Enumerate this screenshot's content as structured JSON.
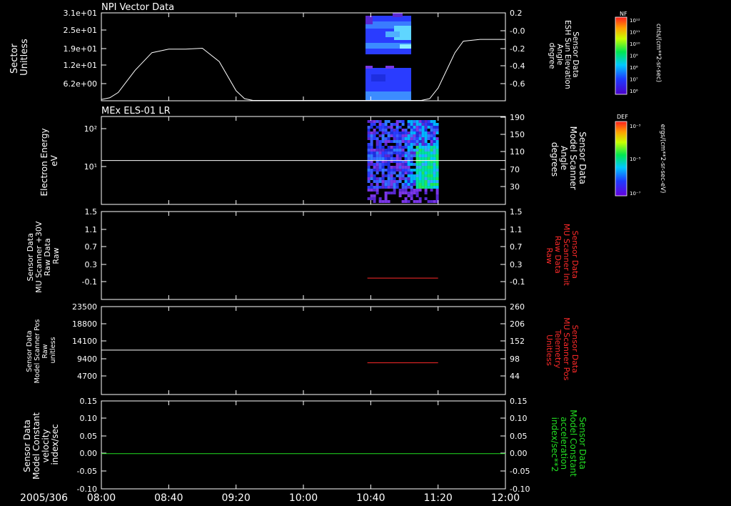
{
  "chart_data": {
    "type": "multi-panel time series",
    "time_axis": {
      "date_label": "2005/306",
      "ticks": [
        "08:00",
        "08:40",
        "09:20",
        "10:00",
        "10:40",
        "11:20",
        "12:00"
      ]
    },
    "panels": [
      {
        "title": "NPI Vector Data",
        "type": "spectrogram + line",
        "left_label": [
          "Sector",
          "Unitless"
        ],
        "left_ticks": [
          "3.1e+01",
          "2.5e+01",
          "1.9e+01",
          "1.2e+01",
          "6.2e+00"
        ],
        "right_label": [
          "Sensor Data",
          "ESH Sun Elevation",
          "Angle",
          "degree"
        ],
        "right_ticks": [
          "0.2",
          "-0.0",
          "-0.2",
          "-0.4",
          "-0.6"
        ],
        "colorbar": {
          "title": "NF",
          "unit": "cnts/(cm**2-sr-sec)",
          "ticks": [
            "10¹²",
            "10¹¹",
            "10¹⁰",
            "10⁹",
            "10⁸",
            "10⁷",
            "10⁶"
          ]
        },
        "series": [
          {
            "name": "ESH Sun Elevation Angle",
            "color": "#ffffff",
            "x": [
              "08:00",
              "08:05",
              "08:10",
              "08:20",
              "08:30",
              "08:40",
              "08:50",
              "09:00",
              "09:10",
              "09:20",
              "09:25",
              "09:30",
              "10:00",
              "10:40",
              "11:00",
              "11:10",
              "11:15",
              "11:20",
              "11:30",
              "11:35",
              "11:45",
              "12:00"
            ],
            "y": [
              -0.78,
              -0.76,
              -0.7,
              -0.45,
              -0.25,
              -0.21,
              -0.21,
              -0.2,
              -0.35,
              -0.68,
              -0.77,
              -0.79,
              -0.79,
              -0.79,
              -0.79,
              -0.79,
              -0.77,
              -0.65,
              -0.25,
              -0.12,
              -0.1,
              -0.1
            ]
          }
        ]
      },
      {
        "title": "MEx ELS-01 LR",
        "type": "spectrogram + line",
        "left_label": [
          "Electron Energy",
          "eV"
        ],
        "left_ticks": [
          "10²",
          "10¹"
        ],
        "right_label": [
          "Sensor Data",
          "Model Scanner",
          "Angle",
          "degrees"
        ],
        "right_ticks": [
          "190",
          "150",
          "110",
          "70",
          "30"
        ],
        "colorbar": {
          "title": "DEF",
          "unit": "ergs/(cm**2-sr-sec-eV)",
          "ticks": [
            "10⁻³",
            "10⁻⁵",
            "10⁻⁷"
          ]
        },
        "series": [
          {
            "name": "Model Scanner Angle",
            "color": "#ffffff",
            "x": [
              "08:00",
              "12:00"
            ],
            "y": [
              90,
              90
            ]
          }
        ]
      },
      {
        "type": "line",
        "left_label": [
          "Sensor Data",
          "MU Scanner +30V",
          "Raw Data",
          "Raw"
        ],
        "left_ticks": [
          "1.5",
          "1.1",
          "0.7",
          "0.3",
          "-0.1"
        ],
        "right_label": [
          "Sensor Data",
          "MU Scanner Init",
          "Raw Data",
          "Raw"
        ],
        "right_ticks": [
          "1.5",
          "1.1",
          "0.7",
          "0.3",
          "-0.1"
        ],
        "right_label_color": "#ff2a2a",
        "series": [
          {
            "name": "MU Scanner Init",
            "color": "#ff2a2a",
            "x": [
              "10:38",
              "11:20"
            ],
            "y": [
              -0.02,
              -0.02
            ]
          }
        ]
      },
      {
        "type": "line",
        "left_label": [
          "Sensor Data",
          "Model Scanner Pos",
          "Raw",
          "unitless"
        ],
        "left_ticks": [
          "23500",
          "18800",
          "14100",
          "9400",
          "4700"
        ],
        "right_label": [
          "Sensor Data",
          "MU Scanner Pos",
          "Telemetry",
          "Unitless"
        ],
        "right_ticks": [
          "260",
          "206",
          "152",
          "98",
          "44"
        ],
        "right_label_color": "#ff2a2a",
        "series": [
          {
            "name": "Model Scanner Pos",
            "color": "#ffffff",
            "x": [
              "08:00",
              "12:00"
            ],
            "y": [
              11700,
              11700
            ]
          },
          {
            "name": "MU Scanner Pos",
            "color": "#ff2a2a",
            "x": [
              "10:38",
              "11:20"
            ],
            "y": [
              85,
              85
            ]
          }
        ]
      },
      {
        "type": "line",
        "left_label": [
          "Sensor Data",
          "Model Constant",
          "velocity",
          "index/sec"
        ],
        "left_ticks": [
          "0.15",
          "0.10",
          "0.05",
          "0.00",
          "-0.05",
          "-0.10"
        ],
        "right_label": [
          "Sensor Data",
          "Model Constant",
          "acceleration",
          "index/sec**2"
        ],
        "right_ticks": [
          "0.15",
          "0.10",
          "0.05",
          "0.00",
          "-0.05",
          "-0.10"
        ],
        "right_label_color": "#22dd22",
        "series": [
          {
            "name": "Model Constant acceleration",
            "color": "#22dd22",
            "x": [
              "08:00",
              "12:00"
            ],
            "y": [
              0,
              0
            ]
          }
        ]
      }
    ]
  }
}
